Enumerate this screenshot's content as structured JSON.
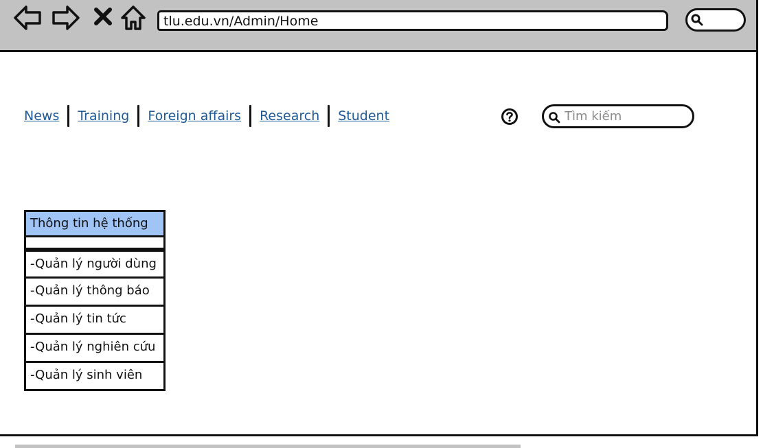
{
  "browser": {
    "url": "tlu.edu.vn/Admin/Home",
    "icons": [
      "back-arrow-icon",
      "forward-arrow-icon",
      "close-icon",
      "home-icon",
      "search-icon"
    ]
  },
  "nav": {
    "links": [
      "News",
      "Training",
      "Foreign affairs",
      "Research",
      "Student"
    ],
    "link_color": "#1f5a99"
  },
  "search": {
    "placeholder": "Tìm kiếm"
  },
  "admin_menu": {
    "header": "Thông tin hệ thống",
    "header_color": "#9fc4f5",
    "items": [
      "-Quản lý người dùng",
      "-Quản lý thông báo",
      "-Quản lý tin tức",
      "-Quản lý nghiên cứu",
      "-Quản lý sinh viên"
    ]
  }
}
